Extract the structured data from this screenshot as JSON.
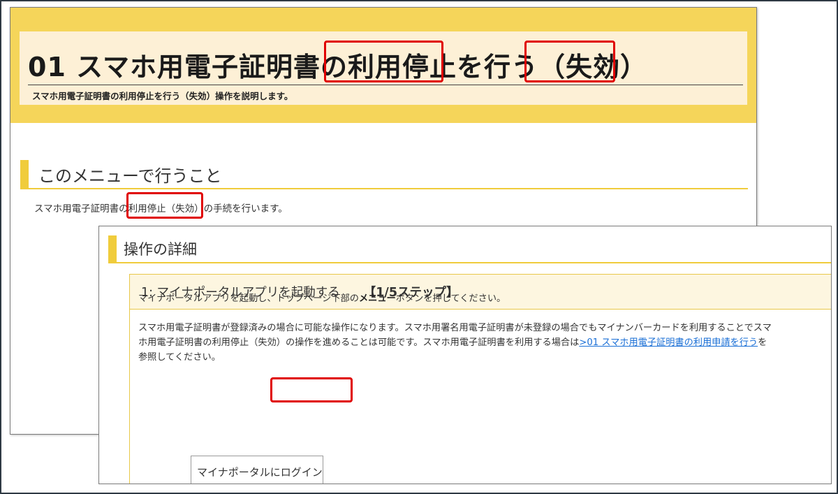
{
  "back_window": {
    "hero_title": "01 スマホ用電子証明書の利用停止を行う（失効）",
    "hero_subtitle": "スマホ用電子証明書の利用停止を行う（失効）操作を説明します。",
    "section_title": "このメニューで行うこと",
    "body_text": "スマホ用電子証明書の利用停止（失効）の手続を行います。"
  },
  "front_window": {
    "section_title": "操作の詳細",
    "step": {
      "title": "1: マイナポータルアプリを起動する",
      "count": "【1/5ステップ】"
    },
    "paragraph1": {
      "before": "マイナポータルアプリを起動し、トップページ下部の",
      "bold": "メニュー",
      "after": "ボタンを押してください。"
    },
    "paragraph2": {
      "before": "スマホ用電子証明書が登録済みの場合に可能な操作になります。スマホ用署名用電子証明書が未登録の場合でもマイナンバーカードを利用することでスマホ用電子証明書の利用停止（失効）の操作を進めることは可能です。スマホ用電子証明書を利用する場合は",
      "link": ">01 スマホ用電子証明書の利用申請を行う",
      "after": "を参照してください。"
    },
    "login_button": "マイナポータルにログイン"
  },
  "colors": {
    "hero_yellow": "#f5d55a",
    "hero_inner": "#fdf0d6",
    "accent_bar": "#f0cc3c",
    "highlight_red": "#e00000",
    "link_blue": "#1a6fd6"
  }
}
